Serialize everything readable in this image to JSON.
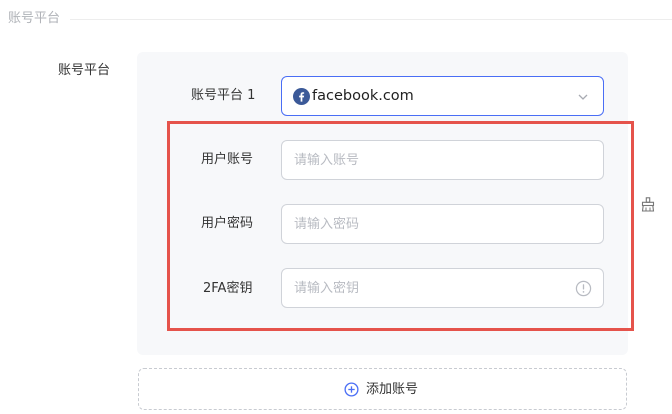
{
  "section": {
    "title": "账号平台"
  },
  "field": {
    "label": "账号平台"
  },
  "platform": {
    "label": "账号平台 1",
    "selected_value": "facebook.com",
    "icon": "facebook-icon",
    "accent_color": "#4a6ef5",
    "icon_color": "#3b5998"
  },
  "credentials": {
    "username_label": "用户账号",
    "username_placeholder": "请输入账号",
    "password_label": "用户密码",
    "password_placeholder": "请输入密码",
    "twofa_label": "2FA密钥",
    "twofa_placeholder": "请输入密钥",
    "twofa_icon": "info-circle-icon"
  },
  "side_icon": "clean-icon",
  "highlight_color": "#e5534b",
  "add_button": {
    "label": "添加账号",
    "icon": "plus-circle-icon",
    "icon_color": "#4a6ef5"
  }
}
